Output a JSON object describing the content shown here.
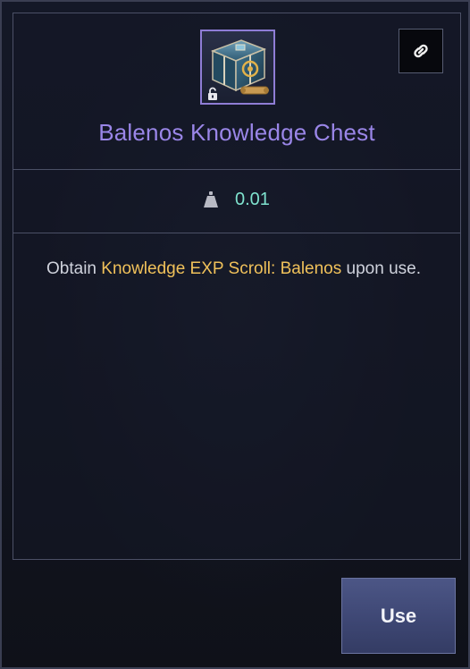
{
  "item": {
    "name": "Balenos Knowledge Chest",
    "icon": "treasure-chest-icon",
    "locked_badge_icon": "padlock-icon",
    "weight_icon": "weight-icon",
    "weight": "0.01",
    "description": {
      "prefix": "Obtain ",
      "highlight": "Knowledge EXP Scroll: Balenos",
      "suffix": " upon use."
    }
  },
  "actions": {
    "link_icon": "link-icon",
    "use_label": "Use"
  },
  "colors": {
    "title": "#9a86e8",
    "weight_value": "#7fe3cf",
    "highlight": "#f0c15a",
    "icon_border": "#8f7dd6",
    "use_button": "#3e4774"
  }
}
